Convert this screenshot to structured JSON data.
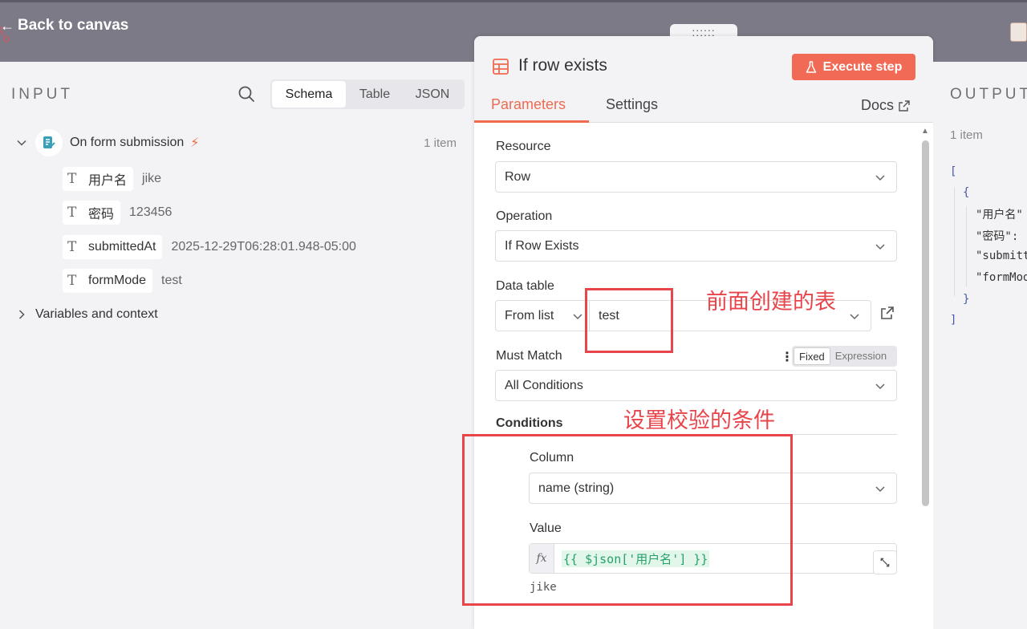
{
  "topbar": {
    "back_label": "Back to canvas",
    "drag_handle": "::::::"
  },
  "input_panel": {
    "title": "INPUT",
    "view_tabs": [
      "Schema",
      "Table",
      "JSON"
    ],
    "active_view": "Schema",
    "node": {
      "name": "On form submission",
      "item_count": "1 item"
    },
    "fields": [
      {
        "type_icon": "T",
        "name": "用户名",
        "value": "jike"
      },
      {
        "type_icon": "T",
        "name": "密码",
        "value": "123456"
      },
      {
        "type_icon": "T",
        "name": "submittedAt",
        "value": "2025-12-29T06:28:01.948-05:00"
      },
      {
        "type_icon": "T",
        "name": "formMode",
        "value": "test"
      }
    ],
    "vars_label": "Variables and context"
  },
  "dialog": {
    "title": "If row exists",
    "execute_label": "Execute step",
    "tabs": [
      "Parameters",
      "Settings"
    ],
    "active_tab": "Parameters",
    "docs_label": "Docs",
    "resource": {
      "label": "Resource",
      "value": "Row"
    },
    "operation": {
      "label": "Operation",
      "value": "If Row Exists"
    },
    "data_table": {
      "label": "Data table",
      "mode": "From list",
      "value": "test"
    },
    "must_match": {
      "label": "Must Match",
      "value": "All Conditions",
      "toggle": [
        "Fixed",
        "Expression"
      ],
      "toggle_active": "Fixed"
    },
    "conditions": {
      "label": "Conditions",
      "column_label": "Column",
      "column_value": "name (string)",
      "value_label": "Value",
      "fx": "fx",
      "expression": "{{ $json['用户名'] }}",
      "expression_result": "jike"
    }
  },
  "output_panel": {
    "title": "OUTPUT",
    "item_count": "1 item",
    "json_lines": [
      "[",
      "{",
      "\"用户名\"",
      "\"密码\":",
      "\"submitt",
      "\"formMod",
      "}",
      "]"
    ]
  },
  "annotations": {
    "table_note": "前面创建的表",
    "conditions_note": "设置校验的条件"
  },
  "colors": {
    "accent": "#f06a50",
    "execute_button": "#f16a55",
    "annotation": "#e8454b",
    "topbar": "#7b7a86"
  }
}
